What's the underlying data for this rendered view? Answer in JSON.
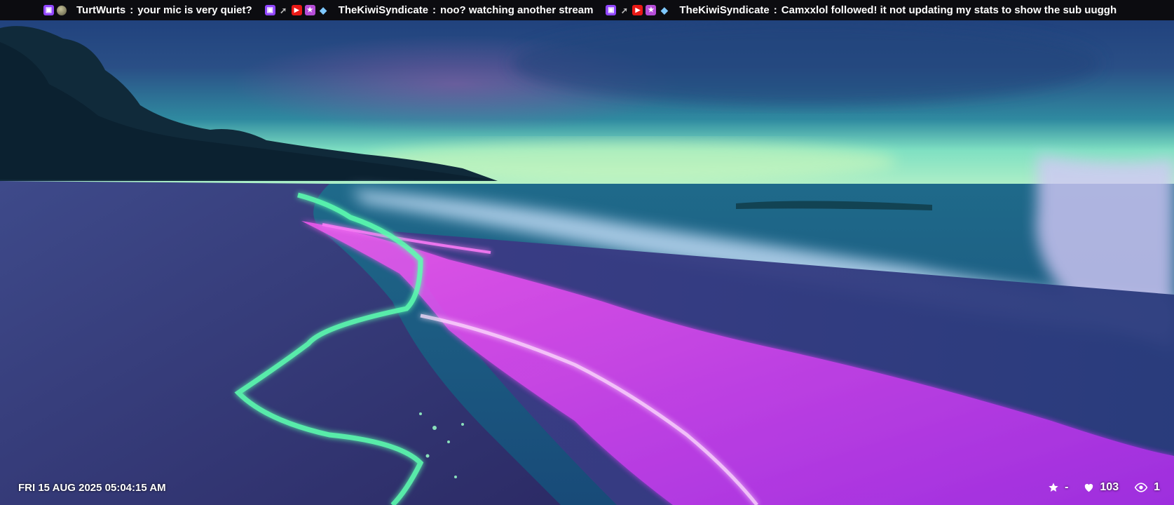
{
  "ticker": {
    "messages": [
      {
        "badges": [
          "twitch",
          "orb"
        ],
        "user": "TurtWurts",
        "separator": ":",
        "text": "your mic is very quiet?"
      },
      {
        "badges": [
          "twitch",
          "cursor",
          "mod",
          "vip",
          "gem"
        ],
        "user": "TheKiwiSyndicate",
        "separator": ":",
        "text": "noo?  watching another stream"
      },
      {
        "badges": [
          "twitch",
          "cursor",
          "mod",
          "vip",
          "gem"
        ],
        "user": "TheKiwiSyndicate",
        "separator": ":",
        "text": "Camxxlol followed!  it not updating my stats to show the sub uuggh"
      }
    ]
  },
  "clock": {
    "datetime": "FRI 15 AUG 2025 05:04:15 AM"
  },
  "stats": {
    "rating": "-",
    "likes": "103",
    "viewers": "1"
  },
  "colors": {
    "twitch_purple": "#9146ff",
    "ticker_bg": "#0c0c10",
    "glow_magenta": "#ff2bf0",
    "glow_green": "#5dffb0"
  }
}
